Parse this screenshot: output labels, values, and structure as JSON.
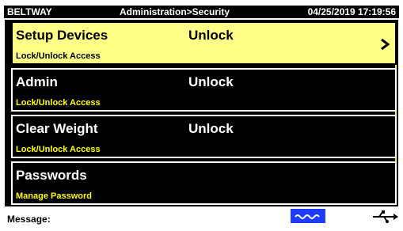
{
  "header": {
    "left": "BELTWAY",
    "center": "Administration>Security",
    "right": "04/25/2019 17:19:56"
  },
  "items": [
    {
      "title": "Setup Devices",
      "status": "Unlock",
      "subtitle": "Lock/Unlock Access"
    },
    {
      "title": "Admin",
      "status": "Unlock",
      "subtitle": "Lock/Unlock Access"
    },
    {
      "title": "Clear Weight",
      "status": "Unlock",
      "subtitle": "Lock/Unlock Access"
    },
    {
      "title": "Passwords",
      "status": "",
      "subtitle": "Manage Password"
    }
  ],
  "statusbar": {
    "message_label": "Message:",
    "icons": [
      "wave-icon",
      "usb-icon"
    ]
  }
}
